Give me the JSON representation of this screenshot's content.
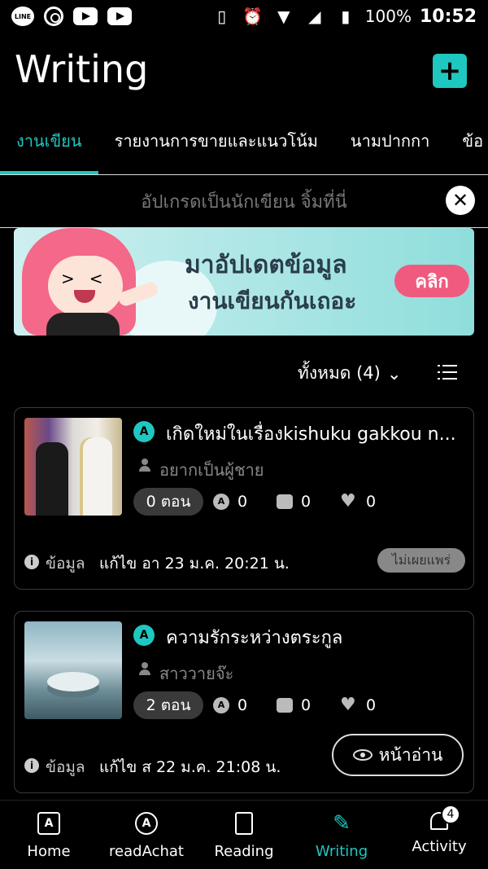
{
  "status_bar": {
    "battery": "100%",
    "time": "10:52",
    "icons": [
      "line-icon",
      "chrome-icon",
      "youtube-icon",
      "youtube-icon",
      "vibrate-icon",
      "alarm-icon",
      "wifi-icon",
      "signal-icon",
      "battery-icon"
    ]
  },
  "header": {
    "title": "Writing",
    "add_icon": "plus-icon"
  },
  "tabs": [
    {
      "label": "งานเขียน",
      "active": true
    },
    {
      "label": "รายงานการขายและแนวโน้ม",
      "active": false
    },
    {
      "label": "นามปากกา",
      "active": false
    },
    {
      "label": "ข้อ",
      "active": false
    }
  ],
  "upgrade_banner": {
    "text": "อัปเกรดเป็นนักเขียน จิ้มที่นี่"
  },
  "promo": {
    "title": "มาอัปเดตข้อมูล",
    "subtitle": "งานเขียนกันเถอะ",
    "button": "คลิก"
  },
  "filter": {
    "label": "ทั้งหมด (4)"
  },
  "works": [
    {
      "badge": "A",
      "title": "เกิดใหม่ในเรื่องkishuku gakkou n...",
      "author": "อยากเป็นผู้ชาย",
      "episodes": "0 ตอน",
      "chat_count": "0",
      "comment_count": "0",
      "like_count": "0",
      "info_label": "ข้อมูล",
      "edited": "แก้ไข อา 23 ม.ค. 20:21 น.",
      "status": "ไม่เผยแพร่"
    },
    {
      "badge": "A",
      "title": "ความรักระหว่างตระกูล",
      "author": "สาววายจ๊ะ",
      "episodes": "2 ตอน",
      "chat_count": "0",
      "comment_count": "0",
      "like_count": "0",
      "info_label": "ข้อมูล",
      "edited": "แก้ไข ส 22 ม.ค. 21:08 น.",
      "read_button": "หน้าอ่าน"
    }
  ],
  "bottom_nav": [
    {
      "label": "Home",
      "icon": "home-icon",
      "glyph": "A"
    },
    {
      "label": "readAchat",
      "icon": "chat-icon",
      "glyph": "A"
    },
    {
      "label": "Reading",
      "icon": "book-icon",
      "glyph": ""
    },
    {
      "label": "Writing",
      "icon": "pencil-icon",
      "glyph": "✎",
      "active": true
    },
    {
      "label": "Activity",
      "icon": "bell-icon",
      "glyph": "",
      "badge": "4"
    }
  ],
  "colors": {
    "accent": "#1ec8c0",
    "promo_button": "#f05a7e",
    "background": "#000000"
  }
}
